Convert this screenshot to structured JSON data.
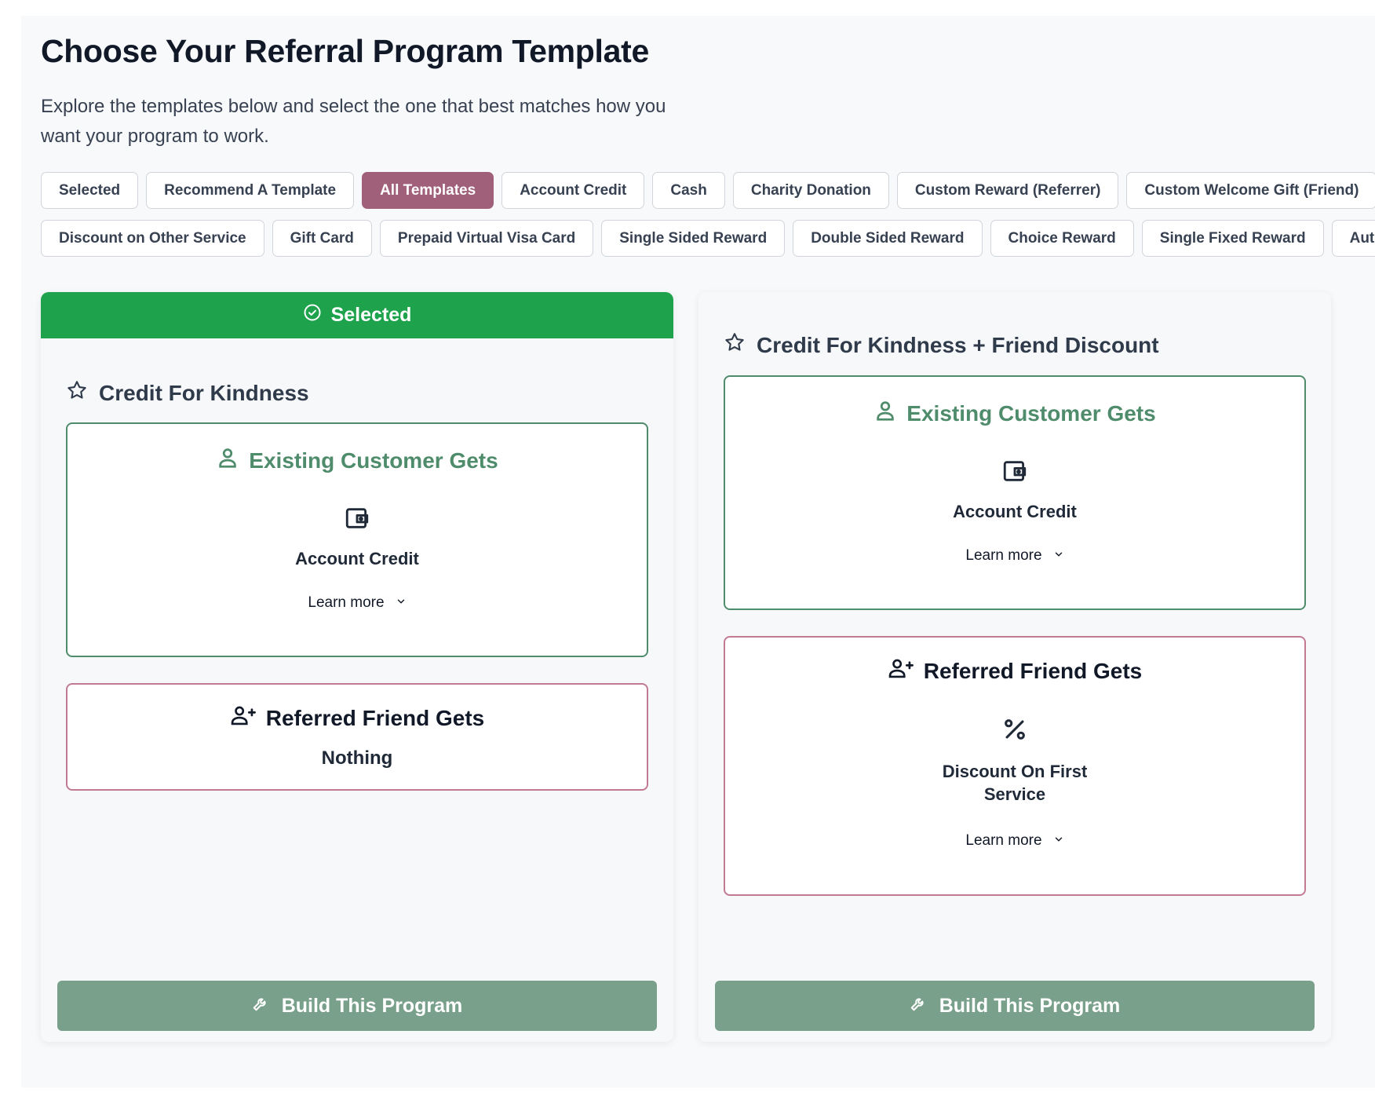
{
  "header": {
    "title": "Choose Your Referral Program Template",
    "subtitle": "Explore the templates below and select the one that best matches how you want your program to work."
  },
  "filters": {
    "active": "All Templates",
    "row1": [
      "Selected",
      "Recommend A Template",
      "All Templates",
      "Account Credit",
      "Cash",
      "Charity Donation",
      "Custom Reward (Referrer)",
      "Custom Welcome Gift (Friend)"
    ],
    "row2": [
      "Discount on Other Service",
      "Gift Card",
      "Prepaid Virtual Visa Card",
      "Single Sided Reward",
      "Double Sided Reward",
      "Choice Reward",
      "Single Fixed Reward",
      "Aut"
    ]
  },
  "templates": [
    {
      "selected_label": "Selected",
      "title": "Credit For Kindness",
      "existing": {
        "heading": "Existing Customer Gets",
        "icon": "wallet-icon",
        "reward": "Account Credit",
        "learn_more": "Learn more"
      },
      "friend": {
        "heading": "Referred Friend Gets",
        "text": "Nothing"
      },
      "build_label": "Build This Program"
    },
    {
      "title": "Credit For Kindness + Friend Discount",
      "existing": {
        "heading": "Existing Customer Gets",
        "icon": "wallet-icon",
        "reward": "Account Credit",
        "learn_more": "Learn more"
      },
      "friend": {
        "heading": "Referred Friend Gets",
        "icon": "percent-icon",
        "reward_line1": "Discount On First",
        "reward_line2": "Service",
        "learn_more": "Learn more"
      },
      "build_label": "Build This Program"
    }
  ],
  "colors": {
    "active_chip": "#a0607a",
    "selected_banner": "#1ea34c",
    "existing_accent": "#4f8c6c",
    "friend_border": "#c27a93",
    "build_button": "#79a08a"
  }
}
